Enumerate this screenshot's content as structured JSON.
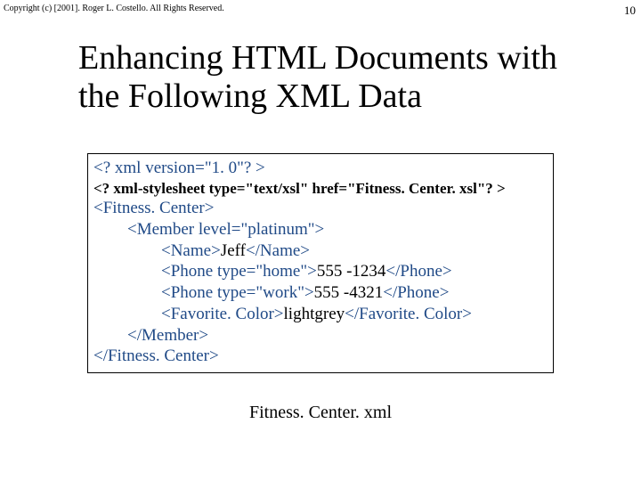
{
  "copyright": "Copyright (c) [2001]. Roger L. Costello. All Rights Reserved.",
  "page_number": "10",
  "title": "Enhancing HTML Documents with the Following XML Data",
  "code": {
    "l1": "<? xml version=\"1. 0\"? >",
    "l2": "<? xml-stylesheet type=\"text/xsl\" href=\"Fitness. Center. xsl\"? >",
    "l3": "<Fitness. Center>",
    "l4": "        <Member level=\"platinum\">",
    "l5_open": "                <Name>",
    "l5_val": "Jeff",
    "l5_close": "</Name>",
    "l6_open": "                <Phone type=\"home\">",
    "l6_val": "555 -1234",
    "l6_close": "</Phone>",
    "l7_open": "                <Phone type=\"work\">",
    "l7_val": "555 -4321",
    "l7_close": "</Phone>",
    "l8_open": "                <Favorite. Color>",
    "l8_val": "lightgrey",
    "l8_close": "</Favorite. Color>",
    "l9": "        </Member>",
    "l10": "</Fitness. Center>"
  },
  "caption": "Fitness. Center. xml"
}
